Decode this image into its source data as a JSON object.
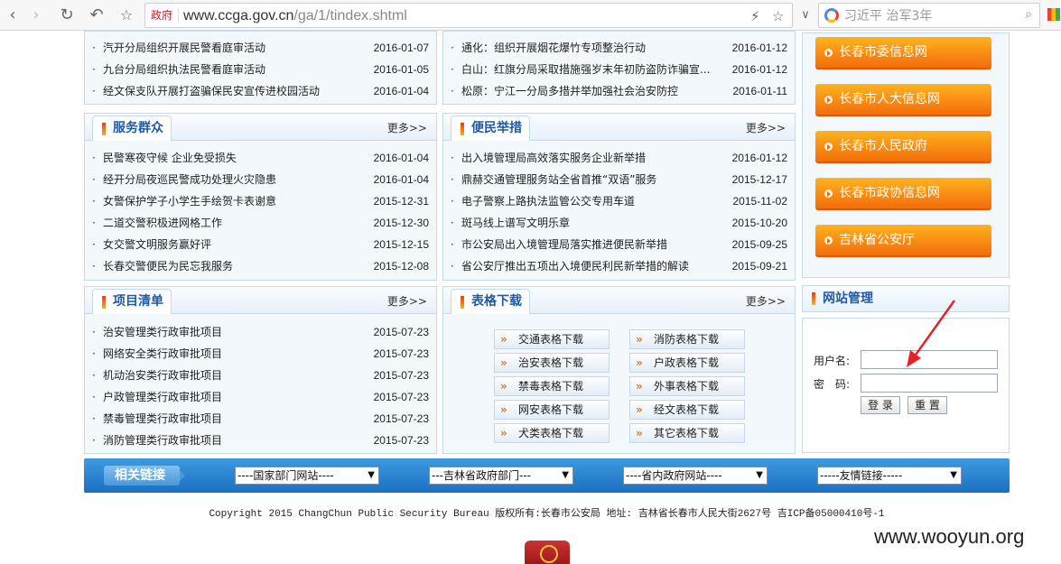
{
  "browser": {
    "address_tag": "政府",
    "url_host": "www.ccga.gov.cn",
    "url_path": "/ga/1/tindex.shtml",
    "search_text": "习近平 治军3年"
  },
  "top_left_list": [
    {
      "title": "汽开分局组织开展民警看庭审活动",
      "date": "2016-01-07"
    },
    {
      "title": "九台分局组织执法民警看庭审活动",
      "date": "2016-01-05"
    },
    {
      "title": "经文保支队开展打盗骗保民安宣传进校园活动",
      "date": "2016-01-04"
    }
  ],
  "top_right_list": [
    {
      "title": "通化：组织开展烟花爆竹专项整治行动",
      "date": "2016-01-12"
    },
    {
      "title": "白山：红旗分局采取措施强岁末年初防盗防诈骗宣...",
      "date": "2016-01-12"
    },
    {
      "title": "松原：宁江一分局多措并举加强社会治安防控",
      "date": "2016-01-11"
    }
  ],
  "service": {
    "title": "服务群众",
    "more": "更多>>",
    "items": [
      {
        "title": "民警寒夜守候 企业免受损失",
        "date": "2016-01-04"
      },
      {
        "title": "经开分局夜巡民警成功处理火灾隐患",
        "date": "2016-01-04"
      },
      {
        "title": "女警保护学子小学生手绘贺卡表谢意",
        "date": "2015-12-31"
      },
      {
        "title": "二道交警积极进网格工作",
        "date": "2015-12-30"
      },
      {
        "title": "女交警文明服务赢好评",
        "date": "2015-12-15"
      },
      {
        "title": "长春交警便民为民忘我服务",
        "date": "2015-12-08"
      }
    ]
  },
  "convenience": {
    "title": "便民举措",
    "more": "更多>>",
    "items": [
      {
        "title": "出入境管理局高效落实服务企业新举措",
        "date": "2016-01-12"
      },
      {
        "title": "鼎赫交通管理服务站全省首推“双语”服务",
        "date": "2015-12-17"
      },
      {
        "title": "电子警察上路执法监管公交专用车道",
        "date": "2015-11-02"
      },
      {
        "title": "斑马线上谱写文明乐章",
        "date": "2015-10-20"
      },
      {
        "title": "市公安局出入境管理局落实推进便民新举措",
        "date": "2015-09-25"
      },
      {
        "title": "省公安厅推出五项出入境便民利民新举措的解读",
        "date": "2015-09-21"
      }
    ]
  },
  "projects": {
    "title": "项目清单",
    "more": "更多>>",
    "items": [
      {
        "title": "治安管理类行政审批项目",
        "date": "2015-07-23"
      },
      {
        "title": "网络安全类行政审批项目",
        "date": "2015-07-23"
      },
      {
        "title": "机动治安类行政审批项目",
        "date": "2015-07-23"
      },
      {
        "title": "户政管理类行政审批项目",
        "date": "2015-07-23"
      },
      {
        "title": "禁毒管理类行政审批项目",
        "date": "2015-07-23"
      },
      {
        "title": "消防管理类行政审批项目",
        "date": "2015-07-23"
      }
    ]
  },
  "downloads": {
    "title": "表格下载",
    "more": "更多>>",
    "arrow_glyph": "»",
    "buttons": [
      "交通表格下载",
      "消防表格下载",
      "治安表格下载",
      "户政表格下载",
      "禁毒表格下载",
      "外事表格下载",
      "网安表格下载",
      "经文表格下载",
      "犬类表格下载",
      "其它表格下载"
    ]
  },
  "side_links": [
    "长春市委信息网",
    "长春市人大信息网",
    "长春市人民政府",
    "长春市政协信息网",
    "吉林省公安厅"
  ],
  "login": {
    "title": "网站管理",
    "username_label": "用户名:",
    "password_label": "密　码:",
    "login_button": "登 录",
    "reset_button": "重 置"
  },
  "links_bar": {
    "title": "相关链接",
    "selects": [
      "----国家部门网站----",
      "---吉林省政府部门---",
      "----省内政府网站----",
      "-----友情链接-----"
    ]
  },
  "footer": {
    "copyright": "Copyright 2015 ChangChun Public Security Bureau 版权所有:长春市公安局 地址: 吉林省长春市人民大街2627号 吉ICP备05000410号-1"
  },
  "watermark": "www.wooyun.org",
  "colors": {
    "accent_blue": "#1e5aa8",
    "orange": "#f36d0a",
    "arrow_red": "#e8202a"
  }
}
